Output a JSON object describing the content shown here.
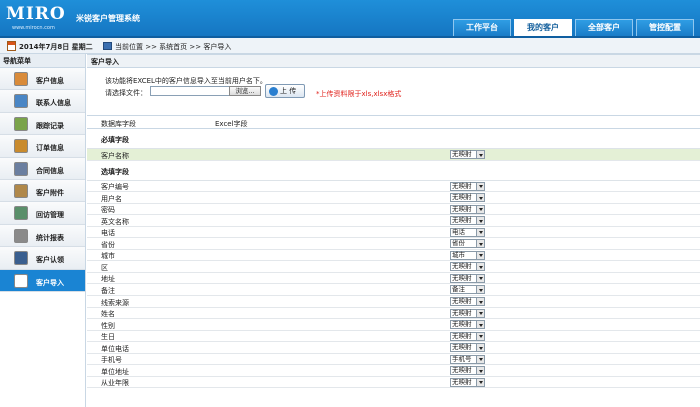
{
  "header": {
    "logo_word": "MIRO",
    "logo_cn": "米锐客户管理系统",
    "logo_url": "www.mirocn.com",
    "tabs": [
      {
        "label": "工作平台",
        "active": false
      },
      {
        "label": "我的客户",
        "active": true
      },
      {
        "label": "全部客户",
        "active": false
      },
      {
        "label": "管控配置",
        "active": false
      }
    ]
  },
  "infobar": {
    "date": "2014年7月8日 星期二",
    "location": "当前位置 >> 系统首页 >> 客户导入"
  },
  "sidebar": {
    "title": "导航菜单",
    "items": [
      {
        "label": "客户信息",
        "icon": "customer-icon",
        "active": false
      },
      {
        "label": "联系人信息",
        "icon": "contact-icon",
        "active": false
      },
      {
        "label": "跟踪记录",
        "icon": "tracking-icon",
        "active": false
      },
      {
        "label": "订单信息",
        "icon": "order-icon",
        "active": false
      },
      {
        "label": "合同信息",
        "icon": "contract-icon",
        "active": false
      },
      {
        "label": "客户附件",
        "icon": "attachment-icon",
        "active": false
      },
      {
        "label": "回访管理",
        "icon": "visit-icon",
        "active": false
      },
      {
        "label": "统计报表",
        "icon": "report-icon",
        "active": false
      },
      {
        "label": "客户认领",
        "icon": "claim-icon",
        "active": false
      },
      {
        "label": "客户导入",
        "icon": "import-icon",
        "active": true
      }
    ]
  },
  "main": {
    "section_title": "客户导入",
    "description": "该功能将EXCEL中的客户信息导入至当前用户名下。",
    "file_label": "请选择文件：",
    "browse_label": "浏览...",
    "upload_label": "上 传",
    "hint": "*上传资料限于xls,xlsx格式",
    "col_db": "数据库字段",
    "col_excel": "Excel字段",
    "required_title": "必填字段",
    "required_fields": [
      {
        "label": "客户名称",
        "value": "无映射"
      }
    ],
    "optional_title": "选填字段",
    "optional_fields": [
      {
        "label": "客户编号",
        "value": "无映射"
      },
      {
        "label": "用户名",
        "value": "无映射"
      },
      {
        "label": "密码",
        "value": "无映射"
      },
      {
        "label": "英文名称",
        "value": "无映射"
      },
      {
        "label": "电话",
        "value": "电话"
      },
      {
        "label": "省份",
        "value": "省份"
      },
      {
        "label": "城市",
        "value": "城市"
      },
      {
        "label": "区",
        "value": "无映射"
      },
      {
        "label": "地址",
        "value": "无映射"
      },
      {
        "label": "备注",
        "value": "备注"
      },
      {
        "label": "线索来源",
        "value": "无映射"
      },
      {
        "label": "姓名",
        "value": "无映射"
      },
      {
        "label": "性别",
        "value": "无映射"
      },
      {
        "label": "生日",
        "value": "无映射"
      },
      {
        "label": "单位电话",
        "value": "无映射"
      },
      {
        "label": "手机号",
        "value": "手机号"
      },
      {
        "label": "单位地址",
        "value": "无映射"
      },
      {
        "label": "从业年限",
        "value": "无映射"
      }
    ]
  },
  "colors": {
    "header_blue": "#1a7cc8",
    "active_menu": "#1a84d3",
    "hint_red": "#e0201a",
    "highlight_row": "#e4f0d6"
  }
}
